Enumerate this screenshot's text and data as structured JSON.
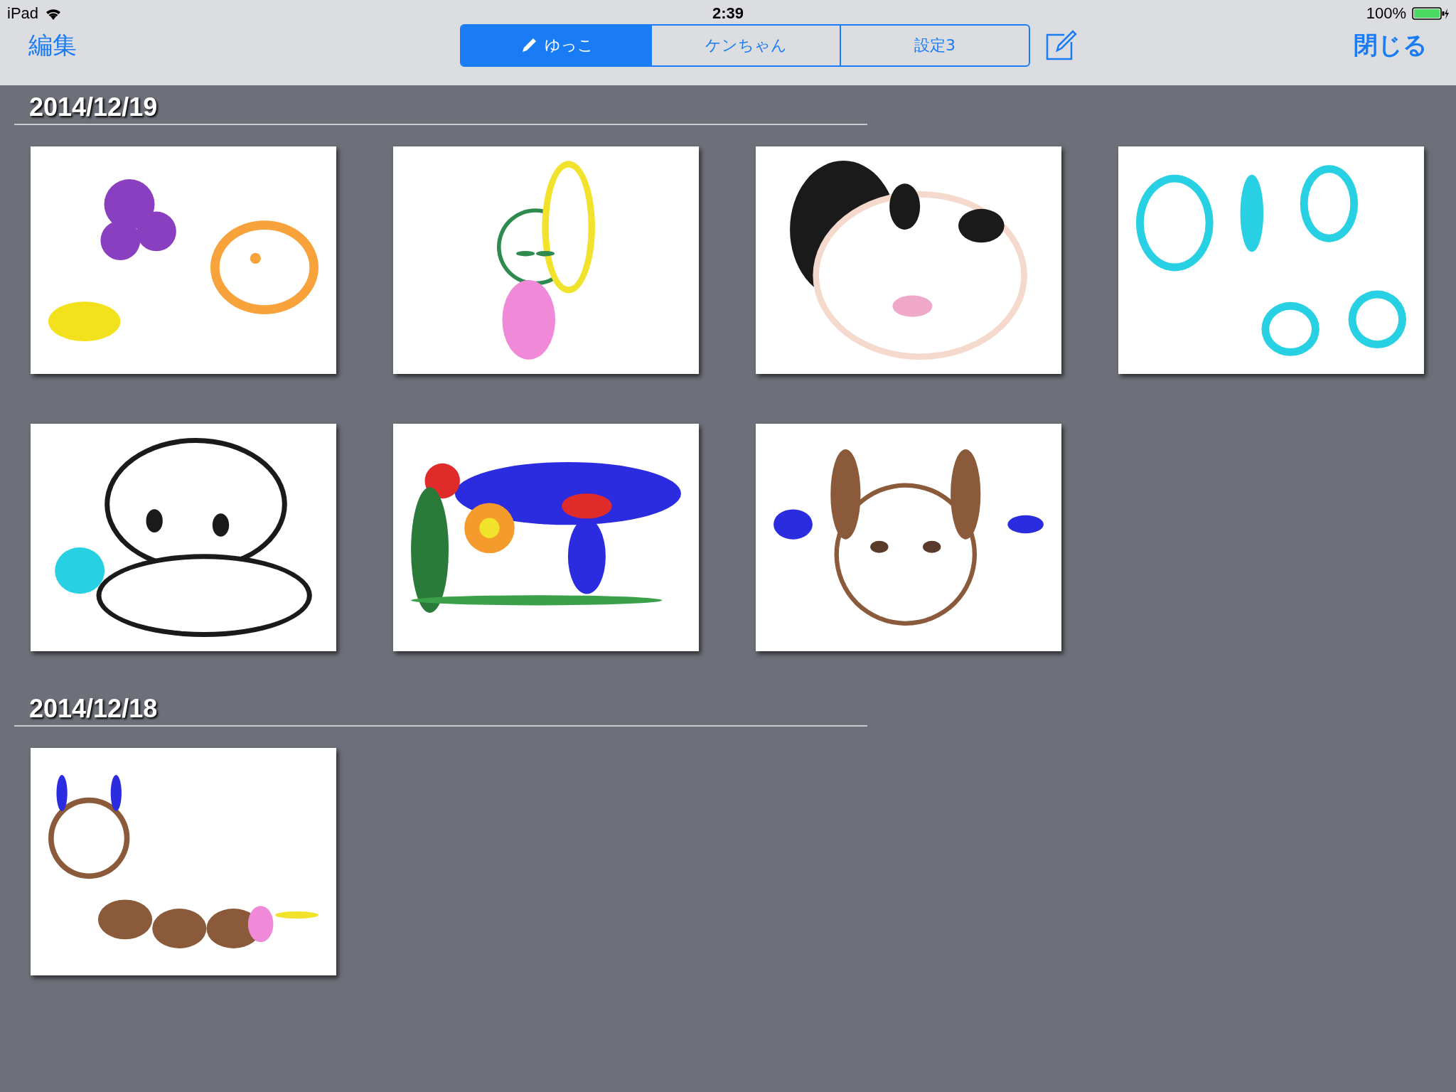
{
  "status_bar": {
    "device": "iPad",
    "time": "2:39",
    "battery": "100%"
  },
  "nav": {
    "edit": "編集",
    "close": "閉じる"
  },
  "tabs": [
    {
      "label": "ゆっこ",
      "selected": true
    },
    {
      "label": "ケンちゃん",
      "selected": false
    },
    {
      "label": "設定3",
      "selected": false
    }
  ],
  "sections": [
    {
      "date": "2014/12/19"
    },
    {
      "date": "2014/12/18"
    }
  ]
}
